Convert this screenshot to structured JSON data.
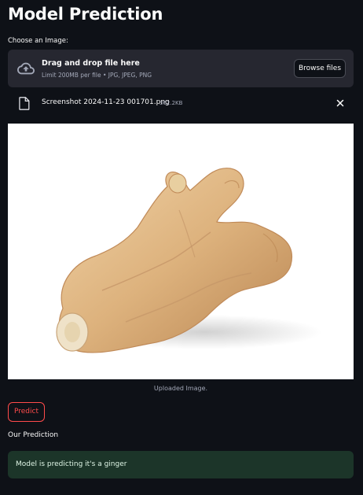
{
  "page": {
    "title": "Model Prediction"
  },
  "uploader": {
    "label": "Choose an Image:",
    "drop_title": "Drag and drop file here",
    "drop_subtitle": "Limit 200MB per file • JPG, JPEG, PNG",
    "browse_label": "Browse files",
    "upload_icon": "cloud-upload-icon"
  },
  "file": {
    "name": "Screenshot 2024-11-23 001701.png",
    "size": "362.2KB",
    "file_icon": "file-icon",
    "remove_icon": "close-icon"
  },
  "image": {
    "caption": "Uploaded Image."
  },
  "actions": {
    "predict_label": "Predict"
  },
  "prediction": {
    "section_label": "Our Prediction",
    "result": "Model is predicting it's a ginger"
  },
  "colors": {
    "background": "#0e1117",
    "panel": "#262730",
    "accent": "#ff4b4b",
    "success_bg": "#1c3529"
  }
}
